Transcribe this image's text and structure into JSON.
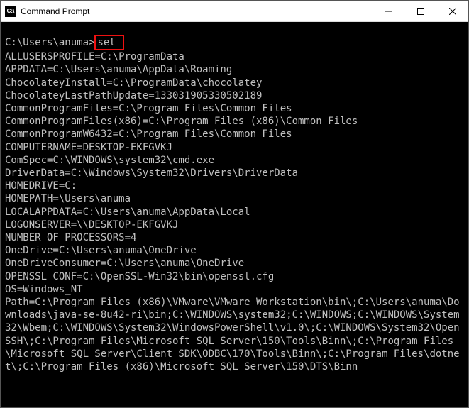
{
  "window": {
    "title": "Command Prompt"
  },
  "prompt": {
    "path": "C:\\Users\\anuma>",
    "command": "set"
  },
  "highlight": {
    "command_highlighted": true
  },
  "env": [
    "ALLUSERSPROFILE=C:\\ProgramData",
    "APPDATA=C:\\Users\\anuma\\AppData\\Roaming",
    "ChocolateyInstall=C:\\ProgramData\\chocolatey",
    "ChocolateyLastPathUpdate=133031905330502189",
    "CommonProgramFiles=C:\\Program Files\\Common Files",
    "CommonProgramFiles(x86)=C:\\Program Files (x86)\\Common Files",
    "CommonProgramW6432=C:\\Program Files\\Common Files",
    "COMPUTERNAME=DESKTOP-EKFGVKJ",
    "ComSpec=C:\\WINDOWS\\system32\\cmd.exe",
    "DriverData=C:\\Windows\\System32\\Drivers\\DriverData",
    "HOMEDRIVE=C:",
    "HOMEPATH=\\Users\\anuma",
    "LOCALAPPDATA=C:\\Users\\anuma\\AppData\\Local",
    "LOGONSERVER=\\\\DESKTOP-EKFGVKJ",
    "NUMBER_OF_PROCESSORS=4",
    "OneDrive=C:\\Users\\anuma\\OneDrive",
    "OneDriveConsumer=C:\\Users\\anuma\\OneDrive",
    "OPENSSL_CONF=C:\\OpenSSL-Win32\\bin\\openssl.cfg",
    "OS=Windows_NT",
    "Path=C:\\Program Files (x86)\\VMware\\VMware Workstation\\bin\\;C:\\Users\\anuma\\Downloads\\java-se-8u42-ri\\bin;C:\\WINDOWS\\system32;C:\\WINDOWS;C:\\WINDOWS\\System32\\Wbem;C:\\WINDOWS\\System32\\WindowsPowerShell\\v1.0\\;C:\\WINDOWS\\System32\\OpenSSH\\;C:\\Program Files\\Microsoft SQL Server\\150\\Tools\\Binn\\;C:\\Program Files\\Microsoft SQL Server\\Client SDK\\ODBC\\170\\Tools\\Binn\\;C:\\Program Files\\dotnet\\;C:\\Program Files (x86)\\Microsoft SQL Server\\150\\DTS\\Binn"
  ]
}
